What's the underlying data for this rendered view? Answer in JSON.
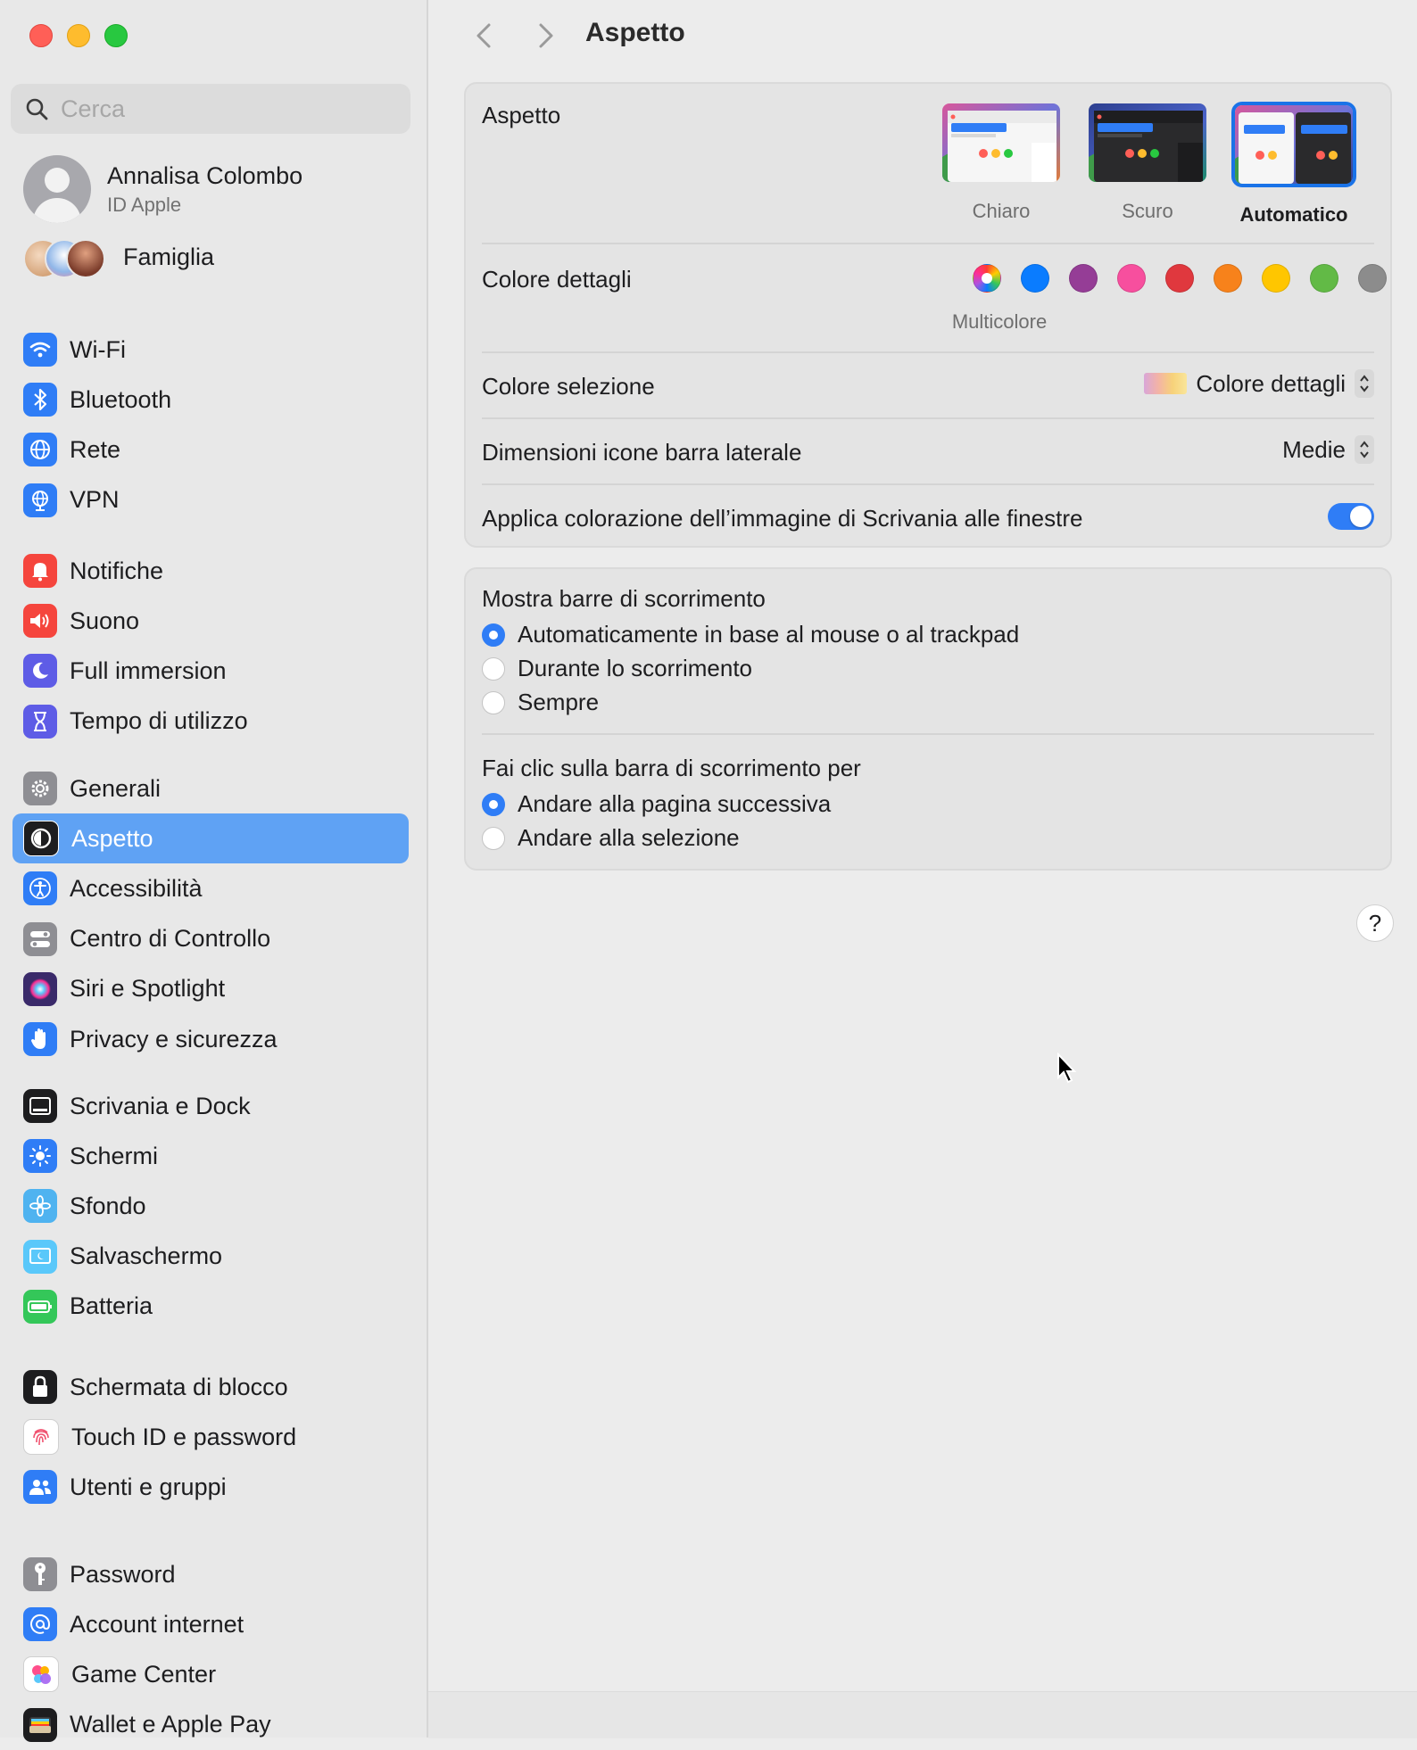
{
  "window": {
    "title": "Aspetto"
  },
  "sidebar": {
    "search_placeholder": "Cerca",
    "account": {
      "name": "Annalisa Colombo",
      "subtitle": "ID Apple"
    },
    "family_label": "Famiglia",
    "groups": [
      [
        {
          "label": "Wi-Fi",
          "icon": "wifi-icon",
          "color": "#2f7df6"
        },
        {
          "label": "Bluetooth",
          "icon": "bluetooth-icon",
          "color": "#2f7df6"
        },
        {
          "label": "Rete",
          "icon": "globe-icon",
          "color": "#2f7df6"
        },
        {
          "label": "VPN",
          "icon": "vpn-globe-icon",
          "color": "#2f7df6"
        }
      ],
      [
        {
          "label": "Notifiche",
          "icon": "bell-icon",
          "color": "#f5453d"
        },
        {
          "label": "Suono",
          "icon": "speaker-icon",
          "color": "#f5453d"
        },
        {
          "label": "Full immersion",
          "icon": "moon-icon",
          "color": "#5e5ce6"
        },
        {
          "label": "Tempo di utilizzo",
          "icon": "hourglass-icon",
          "color": "#5e5ce6"
        }
      ],
      [
        {
          "label": "Generali",
          "icon": "gear-icon",
          "color": "#8e8e93"
        },
        {
          "label": "Aspetto",
          "icon": "appearance-icon",
          "color": "#1d1d1f",
          "selected": true
        },
        {
          "label": "Accessibilità",
          "icon": "accessibility-icon",
          "color": "#2f7df6"
        },
        {
          "label": "Centro di Controllo",
          "icon": "control-center-icon",
          "color": "#8e8e93"
        },
        {
          "label": "Siri e Spotlight",
          "icon": "siri-icon",
          "color": "#3a2a6a"
        },
        {
          "label": "Privacy e sicurezza",
          "icon": "hand-icon",
          "color": "#2f7df6"
        }
      ],
      [
        {
          "label": "Scrivania e Dock",
          "icon": "dock-icon",
          "color": "#1d1d1f"
        },
        {
          "label": "Schermi",
          "icon": "sun-icon",
          "color": "#2f7df6"
        },
        {
          "label": "Sfondo",
          "icon": "flower-icon",
          "color": "#4fb3f0"
        },
        {
          "label": "Salvaschermo",
          "icon": "screensaver-icon",
          "color": "#5ac8fa"
        },
        {
          "label": "Batteria",
          "icon": "battery-icon",
          "color": "#34c759"
        }
      ],
      [
        {
          "label": "Schermata di blocco",
          "icon": "lock-icon",
          "color": "#1d1d1f"
        },
        {
          "label": "Touch ID e password",
          "icon": "fingerprint-icon",
          "color": "#ffffff"
        },
        {
          "label": "Utenti e gruppi",
          "icon": "users-icon",
          "color": "#2f7df6"
        }
      ],
      [
        {
          "label": "Password",
          "icon": "key-icon",
          "color": "#8e8e93"
        },
        {
          "label": "Account internet",
          "icon": "at-icon",
          "color": "#2f7df6"
        },
        {
          "label": "Game Center",
          "icon": "game-center-icon",
          "color": "#ffffff"
        },
        {
          "label": "Wallet e Apple Pay",
          "icon": "wallet-icon",
          "color": "#1d1d1f"
        }
      ]
    ]
  },
  "main": {
    "title": "Aspetto",
    "appearance": {
      "label": "Aspetto",
      "options": [
        {
          "label": "Chiaro",
          "selected": false
        },
        {
          "label": "Scuro",
          "selected": false
        },
        {
          "label": "Automatico",
          "selected": true
        }
      ]
    },
    "accent": {
      "label": "Colore dettagli",
      "selected_caption": "Multicolore",
      "colors": [
        "multicolor",
        "#0a7cff",
        "#953d96",
        "#f74f9e",
        "#e0383e",
        "#f7821b",
        "#ffc600",
        "#62ba46",
        "#8c8c8c"
      ]
    },
    "highlight": {
      "label": "Colore selezione",
      "value": "Colore dettagli"
    },
    "sidebar_icon_size": {
      "label": "Dimensioni icone barra laterale",
      "value": "Medie"
    },
    "wallpaper_tinting": {
      "label": "Applica colorazione dell’immagine di Scrivania alle finestre",
      "on": true
    },
    "scroll_bars": {
      "label": "Mostra barre di scorrimento",
      "options": [
        {
          "label": "Automaticamente in base al mouse o al trackpad",
          "selected": true
        },
        {
          "label": "Durante lo scorrimento",
          "selected": false
        },
        {
          "label": "Sempre",
          "selected": false
        }
      ]
    },
    "click_scroll": {
      "label": "Fai clic sulla barra di scorrimento per",
      "options": [
        {
          "label": "Andare alla pagina successiva",
          "selected": true
        },
        {
          "label": "Andare alla selezione",
          "selected": false
        }
      ]
    },
    "help_label": "?"
  }
}
